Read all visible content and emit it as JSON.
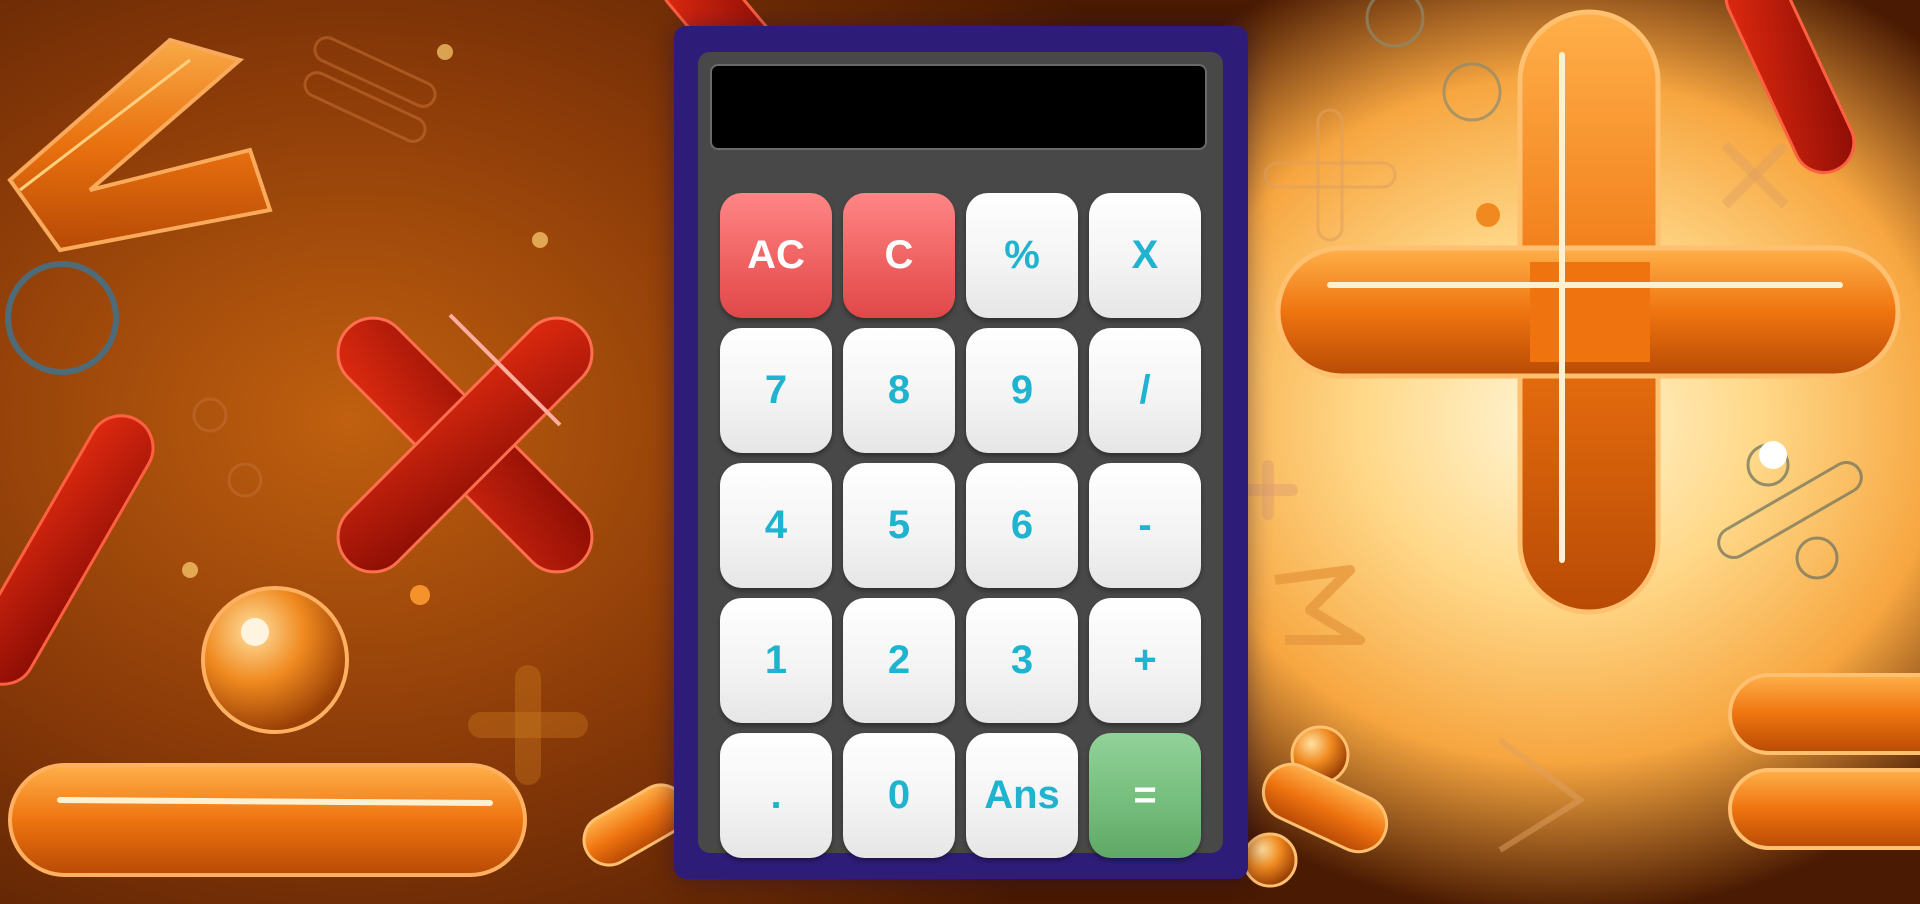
{
  "display": {
    "value": ""
  },
  "keys": [
    {
      "id": "ac",
      "label": "AC",
      "kind": "clear"
    },
    {
      "id": "c",
      "label": "C",
      "kind": "clear"
    },
    {
      "id": "percent",
      "label": "%",
      "kind": "op"
    },
    {
      "id": "multiply",
      "label": "X",
      "kind": "op"
    },
    {
      "id": "7",
      "label": "7",
      "kind": "digit"
    },
    {
      "id": "8",
      "label": "8",
      "kind": "digit"
    },
    {
      "id": "9",
      "label": "9",
      "kind": "digit"
    },
    {
      "id": "divide",
      "label": "/",
      "kind": "op"
    },
    {
      "id": "4",
      "label": "4",
      "kind": "digit"
    },
    {
      "id": "5",
      "label": "5",
      "kind": "digit"
    },
    {
      "id": "6",
      "label": "6",
      "kind": "digit"
    },
    {
      "id": "minus",
      "label": "-",
      "kind": "op"
    },
    {
      "id": "1",
      "label": "1",
      "kind": "digit"
    },
    {
      "id": "2",
      "label": "2",
      "kind": "digit"
    },
    {
      "id": "3",
      "label": "3",
      "kind": "digit"
    },
    {
      "id": "plus",
      "label": "+",
      "kind": "op"
    },
    {
      "id": "decimal",
      "label": ".",
      "kind": "digit"
    },
    {
      "id": "0",
      "label": "0",
      "kind": "digit"
    },
    {
      "id": "ans",
      "label": "Ans",
      "kind": "op"
    },
    {
      "id": "equals",
      "label": "=",
      "kind": "equals"
    }
  ],
  "colors": {
    "frame": "#2e1d78",
    "body": "#484848",
    "display": "#000000",
    "key_text": "#1fb3cf",
    "clear_key": "#f06262",
    "equals_key": "#78c07f"
  }
}
